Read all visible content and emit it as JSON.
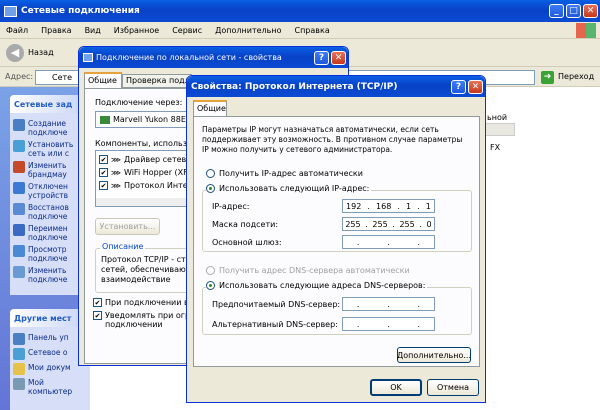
{
  "explorer": {
    "title": "Сетевые подключения",
    "menu": [
      "Файл",
      "Правка",
      "Вид",
      "Избранное",
      "Сервис",
      "Дополнительно",
      "Справка"
    ],
    "back_label": "Назад",
    "address_label": "Адрес:",
    "address_value": "Сете",
    "go_label": "Переход",
    "tasks_header": "Сетевые зад",
    "tasks": [
      {
        "label": "Создание\nподключе"
      },
      {
        "label": "Установить\nсеть или с"
      },
      {
        "label": "Изменить\nбрандмау"
      },
      {
        "label": "Отключен\nустройств"
      },
      {
        "label": "Восстанов\nподключе"
      },
      {
        "label": "Переимен\nподключе"
      },
      {
        "label": "Просмотр\nподключе"
      },
      {
        "label": "Изменить\nподключе"
      }
    ],
    "other_header": "Другие мест",
    "other": [
      {
        "label": "Панель уп"
      },
      {
        "label": "Сетевое о"
      },
      {
        "label": "Мои докум"
      },
      {
        "label": "Мой компьютер"
      }
    ],
    "right_text_1": "ьной",
    "right_text_2": "FX"
  },
  "lan": {
    "title": "Подключение по локальной сети - свойства",
    "tabs": [
      "Общие",
      "Проверка подлинн"
    ],
    "connect_via": "Подключение через:",
    "adapter": "Marvell Yukon 88E",
    "components_label": "Компоненты, использу",
    "components": [
      {
        "label": "Драйвер сетев"
      },
      {
        "label": "WiFi Hopper (XF"
      },
      {
        "label": "Протокол Инте"
      }
    ],
    "install_label": "Установить...",
    "description_header": "Описание",
    "description": "Протокол TCP/IP - ст\nсетей, обеспечиваю\nвзаимодействие",
    "chk1": "При подключении вы",
    "chk2": "Уведомлять при огр\nподключении"
  },
  "tcpip": {
    "title": "Свойства: Протокол Интернета (TCP/IP)",
    "tab": "Общие",
    "intro": "Параметры IP могут назначаться автоматически, если сеть поддерживает эту возможность. В противном случае параметры IP можно получить у сетевого администратора.",
    "radio_auto_ip": "Получить IP-адрес автоматически",
    "radio_manual_ip": "Использовать следующий IP-адрес:",
    "ip_label": "IP-адрес:",
    "ip": [
      "192",
      "168",
      "1",
      "1"
    ],
    "mask_label": "Маска подсети:",
    "mask": [
      "255",
      "255",
      "255",
      "0"
    ],
    "gateway_label": "Основной шлюз:",
    "radio_auto_dns": "Получить адрес DNS-сервера автоматически",
    "radio_manual_dns": "Использовать следующие адреса DNS-серверов:",
    "dns1_label": "Предпочитаемый DNS-сервер:",
    "dns2_label": "Альтернативный DNS-сервер:",
    "advanced_label": "Дополнительно...",
    "ok_label": "OK",
    "cancel_label": "Отмена"
  }
}
